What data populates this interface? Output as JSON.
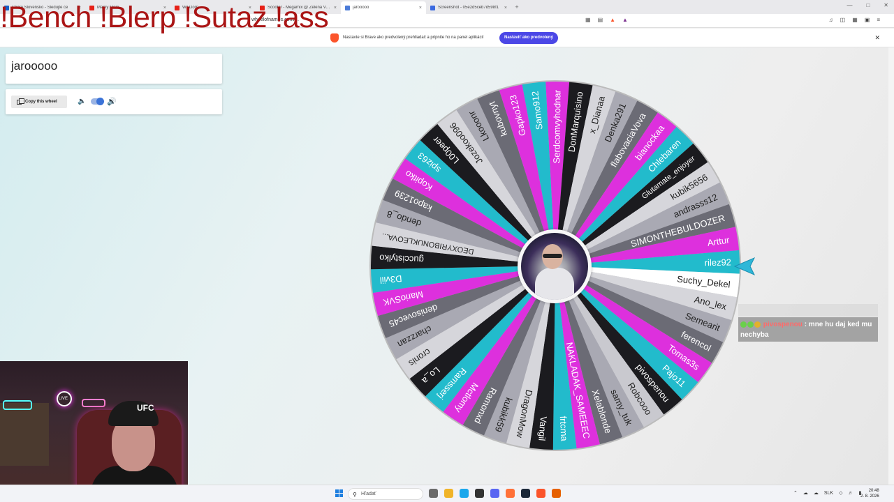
{
  "browser": {
    "tabs": [
      {
        "label": "Shore Slovensko - Sledujte ce",
        "color": "#1560c9",
        "active": false
      },
      {
        "label": "Marky Mark",
        "color": "#e62117",
        "active": false
      },
      {
        "label": "Wil Dorn",
        "color": "#e62117",
        "active": false
      },
      {
        "label": "Scooter - Megamix @ Zelená Voda",
        "color": "#e62117",
        "active": false
      },
      {
        "label": "jarooooo",
        "color": "#4b7bd8",
        "active": true
      },
      {
        "label": "Screenshot - 05e2d5ceb7d598f1",
        "color": "#3b6ae0",
        "active": false
      }
    ],
    "new_tab": "+",
    "url": "wheelofnames.com/...",
    "infobar_message": "Nastavte si Brave ako predvolený prehliadač a pripnite ho na panel aplikácií",
    "infobar_button": "Nastaviť ako predvolený",
    "close_glyph": "✕"
  },
  "overlay_text": "!Bench !Blerp !Sutaz !ass",
  "wheel_title": "jarooooo",
  "controls": {
    "copy_label": "Copy this wheel",
    "sound_enabled": true
  },
  "wheel": {
    "names": [
      "rilez92",
      "Suchy_Dekel",
      "Ano_lex",
      "Semearit",
      "ferencol",
      "Tomas3s",
      "Pajo11",
      "pivospenou",
      "Robcooo",
      "samy_tuk",
      "Xelablonde",
      "NAKLADAK_SAMEEEC",
      "frtcma",
      "Vangil",
      "DragonMow",
      "kubikk59",
      "Ramonxd",
      "Mctlomy",
      "Ramsserj",
      "Lo_a",
      "cronis",
      "charzzan",
      "denisovec45",
      "MarioSVK",
      "D3viil",
      "guccistylko",
      "DEOXYRIBONUKLEOVA...",
      "dendo_8",
      "kapo1239",
      "Kopitko",
      "spiz63",
      "L00peer",
      "Jozekoo096",
      "Lkooonr",
      "kubovnyt",
      "Gapko123",
      "Samo912",
      "Serdcomvyhodnar",
      "DonMarquisino",
      "x_Dianaa",
      "Denka291",
      "flabovaciaVova",
      "bianockaa",
      "Chlebaren",
      "Glutamate_enjoyer",
      "kubik5656",
      "andrasss12",
      "SIMONTHEBULDOZER",
      "Arttur"
    ],
    "colors": [
      "#22bbcc",
      "#ffffff",
      "#d6d6db",
      "#a9a9b3",
      "#6b6b75",
      "#dd30dd",
      "#22bbcc",
      "#1b1b1f",
      "#c9c9cf",
      "#a9a9b3",
      "#6b6b75",
      "#dd30dd",
      "#22bbcc",
      "#1b1b1f",
      "#d6d6db",
      "#a9a9b3",
      "#6b6b75",
      "#dd30dd",
      "#22bbcc",
      "#1b1b1f",
      "#d6d6db",
      "#a9a9b3",
      "#6b6b75",
      "#dd30dd",
      "#22bbcc",
      "#1b1b1f",
      "#d6d6db",
      "#a9a9b3",
      "#6b6b75",
      "#dd30dd",
      "#22bbcc",
      "#1b1b1f",
      "#d6d6db",
      "#a9a9b3",
      "#6b6b75",
      "#dd30dd",
      "#22bbcc",
      "#dd30dd",
      "#1b1b1f",
      "#d6d6db",
      "#a9a9b3",
      "#6b6b75",
      "#dd30dd",
      "#22bbcc",
      "#1b1b1f",
      "#d6d6db",
      "#a9a9b3",
      "#6b6b75",
      "#dd30dd"
    ]
  },
  "chat": {
    "ghost": "",
    "user": "pivospenou",
    "message": ": mne hu daj ked mu nechyba",
    "badge_colors": [
      "#6ad04b",
      "#6ad04b",
      "#e3b12a"
    ]
  },
  "webcam": {
    "cap_text": "UFC",
    "neon_text": "LIVE"
  },
  "taskbar": {
    "search_placeholder": "Hľadať",
    "icons": [
      "#6b6b6b",
      "#f0b429",
      "#1aa7ec",
      "#333333",
      "#5865f2",
      "#ff7139",
      "#1b2838",
      "#fb542b",
      "#e66000"
    ],
    "lang": "SLK",
    "time": "20:48",
    "date": "2. 8. 2026"
  }
}
